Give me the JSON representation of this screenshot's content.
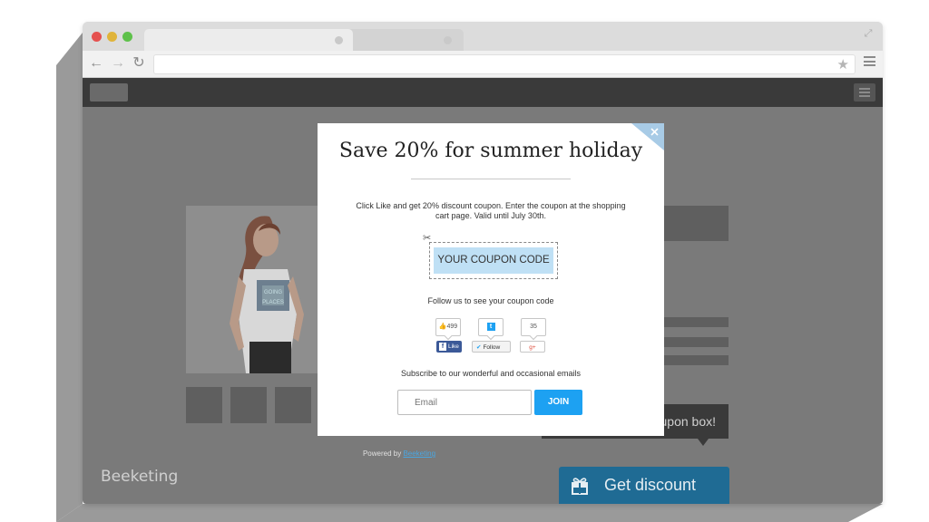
{
  "popup": {
    "title": "Save 20% for summer holiday",
    "description": "Click Like and get 20% discount coupon. Enter the coupon at the shopping cart page. Valid until July 30th.",
    "coupon_code": "YOUR COUPON CODE",
    "follow_text": "Follow us to see your coupon code",
    "social": {
      "facebook_count": "499",
      "facebook_label": "Like",
      "twitter_label": "Follow",
      "google_count": "35",
      "google_label": "g+"
    },
    "subscribe_text": "Subscribe to our wonderful and occasional emails",
    "email_placeholder": "Email",
    "join_label": "JOIN"
  },
  "powered_by": {
    "prefix": "Powered by",
    "link": "Beeketing"
  },
  "page": {
    "tooltip_text": "upon box!",
    "get_discount_label": "Get discount",
    "brand_name": "Beeketing",
    "product_shirt_text": "GOING PLACES"
  },
  "colors": {
    "accent_blue": "#1da1f2",
    "coupon_bg": "#bfe0f5",
    "discount_button": "#1f6b94",
    "facebook": "#3b5998",
    "twitter": "#1da1f2",
    "google": "#dd4b39"
  },
  "icons": [
    "back-arrow-icon",
    "forward-arrow-icon",
    "reload-icon",
    "star-icon",
    "menu-icon",
    "close-icon",
    "scissors-icon",
    "thumbs-up-icon",
    "twitter-bird-icon",
    "gift-icon",
    "expand-icon"
  ]
}
